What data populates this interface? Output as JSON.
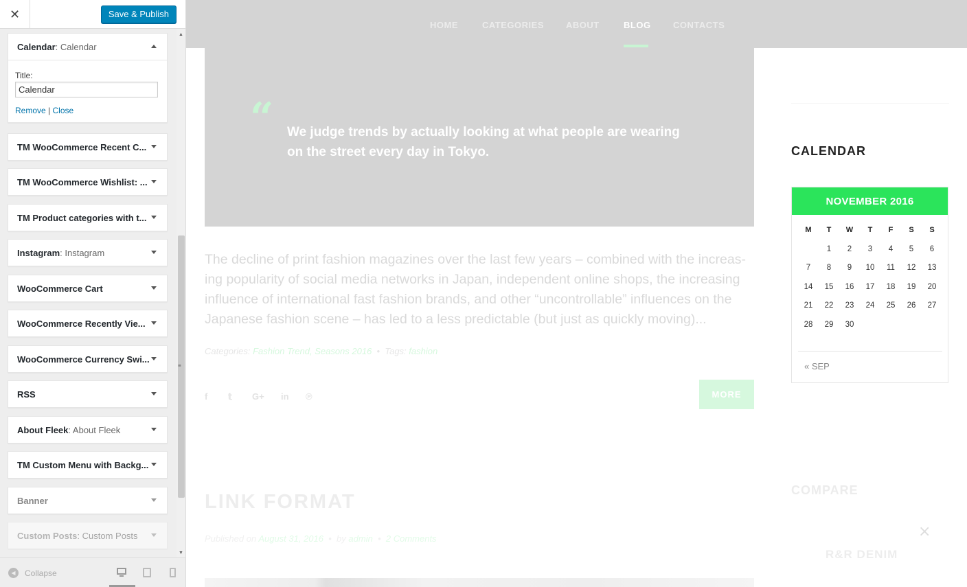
{
  "sidebar": {
    "close_icon": "close-icon",
    "publish_label": "Save & Publish",
    "expanded_widget": {
      "title": "Calendar",
      "instance": ": Calendar",
      "field_label": "Title:",
      "field_value": "Calendar",
      "remove_label": "Remove",
      "separator": "|",
      "close_label": "Close"
    },
    "widgets": [
      {
        "title": "TM WooCommerce Recent C...",
        "instance": ""
      },
      {
        "title": "TM WooCommerce Wishlist: ...",
        "instance": ""
      },
      {
        "title": "TM Product categories with t...",
        "instance": ""
      },
      {
        "title": "Instagram",
        "instance": ": Instagram"
      },
      {
        "title": "WooCommerce Cart",
        "instance": ""
      },
      {
        "title": "WooCommerce Recently Vie...",
        "instance": ""
      },
      {
        "title": "WooCommerce Currency Swi...",
        "instance": ""
      },
      {
        "title": "RSS",
        "instance": ""
      },
      {
        "title": "About Fleek",
        "instance": ": About Fleek"
      },
      {
        "title": "TM Custom Menu with Backg...",
        "instance": ""
      },
      {
        "title": "Banner",
        "instance": ""
      },
      {
        "title": "Custom Posts",
        "instance": ": Custom Posts"
      }
    ],
    "collapse_label": "Collapse",
    "preview_devices": [
      "desktop",
      "tablet",
      "mobile"
    ],
    "active_device": "desktop"
  },
  "preview": {
    "nav": [
      {
        "label": "Home"
      },
      {
        "label": "Categories"
      },
      {
        "label": "About"
      },
      {
        "label": "Blog"
      },
      {
        "label": "Contacts"
      }
    ],
    "active_nav": "Blog",
    "quote_text": "We judge trends by actually looking at what people are wearing on the street every day in Tokyo.",
    "excerpt": "The decline of print fashion magazines over the last few years – combined with the increas­ing popularity of social media networks in Japan, independent online shops, the increasing influence of international fast fashion brands, and other “uncontrollable” influences on the Japanese fashion scene – has led to a less predictable (but just as quickly moving)...",
    "meta": {
      "categories_label": "Categories:",
      "categories": "Fashion Trend, Seasons 2016",
      "bullet": "•",
      "tags_label": "Tags:",
      "tags": "fashion"
    },
    "share": {
      "facebook": "f",
      "twitter": "𝕥",
      "googleplus": "G+",
      "linkedin": "in",
      "pinterest": "℗"
    },
    "more_label": "MORE",
    "next_post_title": "LINK FORMAT",
    "published": {
      "prefix": "Published on",
      "date": "August 31, 2016",
      "bullet1": "•",
      "by": "by",
      "author": "admin",
      "bullet2": "•",
      "comments": "2 Comments"
    },
    "calendar": {
      "widget_title": "CALENDAR",
      "month": "NOVEMBER 2016",
      "weekdays": [
        "M",
        "T",
        "W",
        "T",
        "F",
        "S",
        "S"
      ],
      "weeks": [
        [
          "",
          "1",
          "2",
          "3",
          "4",
          "5",
          "6"
        ],
        [
          "7",
          "8",
          "9",
          "10",
          "11",
          "12",
          "13"
        ],
        [
          "14",
          "15",
          "16",
          "17",
          "18",
          "19",
          "20"
        ],
        [
          "21",
          "22",
          "23",
          "24",
          "25",
          "26",
          "27"
        ],
        [
          "28",
          "29",
          "30",
          "",
          "",
          "",
          ""
        ]
      ],
      "prev_link": "« SEP"
    },
    "compare_title": "COMPARE",
    "compare_close": "×",
    "compare_item": "R&R DENIM"
  },
  "colors": {
    "accent_green": "#2be45b",
    "publish_blue": "#0085ba",
    "link_blue": "#0073aa",
    "overlay_gray": "#d4d4d4"
  }
}
